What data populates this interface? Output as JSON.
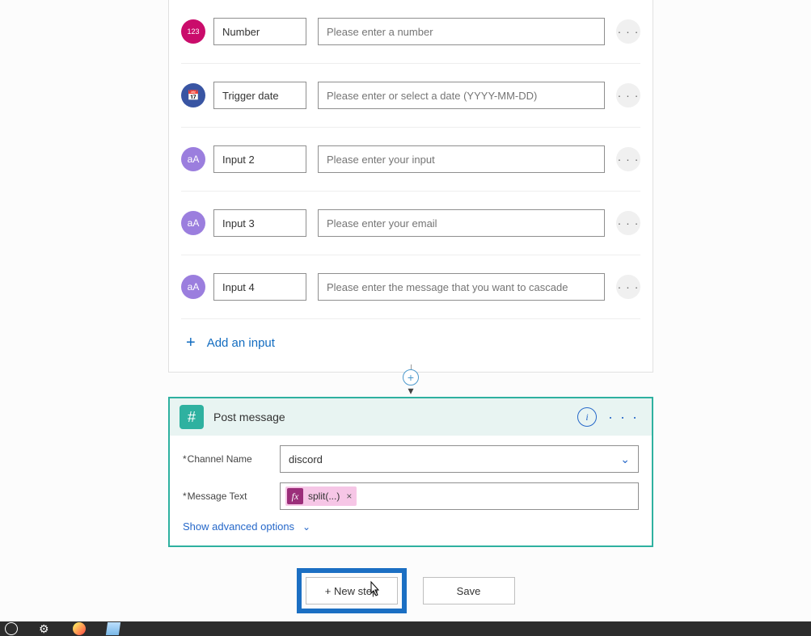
{
  "trigger": {
    "inputs": [
      {
        "iconClass": "ic-number",
        "iconGlyph": "123",
        "iconName": "number-icon",
        "name": "Number",
        "placeholder": "Please enter a number"
      },
      {
        "iconClass": "ic-date",
        "iconGlyph": "📅",
        "iconName": "calendar-icon",
        "name": "Trigger date",
        "placeholder": "Please enter or select a date (YYYY-MM-DD)"
      },
      {
        "iconClass": "ic-text",
        "iconGlyph": "aA",
        "iconName": "text-icon",
        "name": "Input 2",
        "placeholder": "Please enter your input"
      },
      {
        "iconClass": "ic-text",
        "iconGlyph": "aA",
        "iconName": "text-icon",
        "name": "Input 3",
        "placeholder": "Please enter your email"
      },
      {
        "iconClass": "ic-text",
        "iconGlyph": "aA",
        "iconName": "text-icon",
        "name": "Input 4",
        "placeholder": "Please enter the message that you want to cascade"
      }
    ],
    "add_input_label": "Add an input",
    "ellipsis": "· · ·"
  },
  "action": {
    "title": "Post message",
    "hash_glyph": "#",
    "menu_glyph": "· · ·",
    "fields": {
      "channel_label": "Channel Name",
      "channel_value": "discord",
      "message_label": "Message Text",
      "token_fx": "fx",
      "token_text": "split(...)",
      "token_close": "×"
    },
    "advanced_label": "Show advanced options"
  },
  "buttons": {
    "new_step": "+ New step",
    "save": "Save"
  },
  "chevron_down": "⌄",
  "plus": "+",
  "info_glyph": "i",
  "arrow_down": "▾"
}
